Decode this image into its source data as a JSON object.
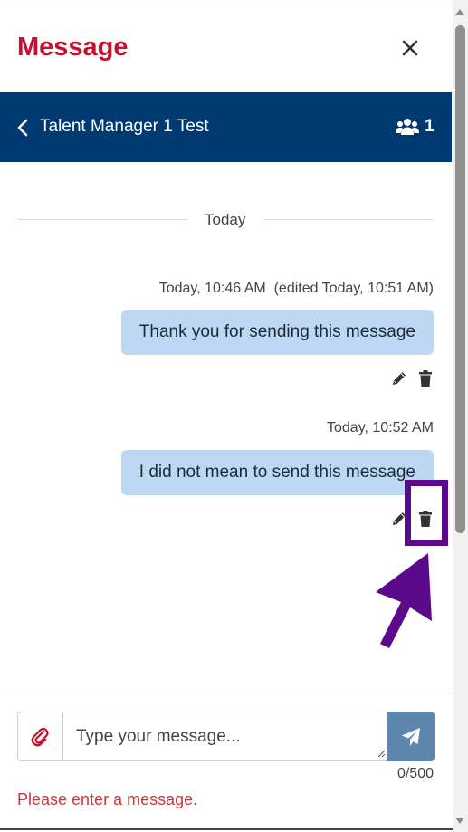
{
  "dialog": {
    "title": "Message",
    "close_icon": "close-icon"
  },
  "conversation": {
    "name": "Talent Manager 1 Test",
    "participant_count": "1",
    "back_icon": "chevron-left-icon",
    "participants_icon": "users-icon"
  },
  "divider": {
    "label": "Today"
  },
  "messages": [
    {
      "meta": "Today, 10:46 AM  (edited Today, 10:51 AM)",
      "text": "Thank you for sending this message",
      "actions": [
        "edit-icon",
        "delete-icon"
      ]
    },
    {
      "meta": "Today, 10:52 AM",
      "text": "I did not mean to send this message",
      "actions": [
        "edit-icon",
        "delete-icon"
      ]
    }
  ],
  "composer": {
    "placeholder": "Type your message...",
    "value": "",
    "char_count": "0/500",
    "error": "Please enter a message.",
    "attach_icon": "paperclip-icon",
    "send_icon": "send-icon"
  },
  "colors": {
    "title": "#c8102e",
    "header_bg": "#003a70",
    "bubble_bg": "#bed8f3",
    "send_bg": "#5f86ac",
    "error": "#d0343c",
    "annotation": "#5b0a8c"
  }
}
